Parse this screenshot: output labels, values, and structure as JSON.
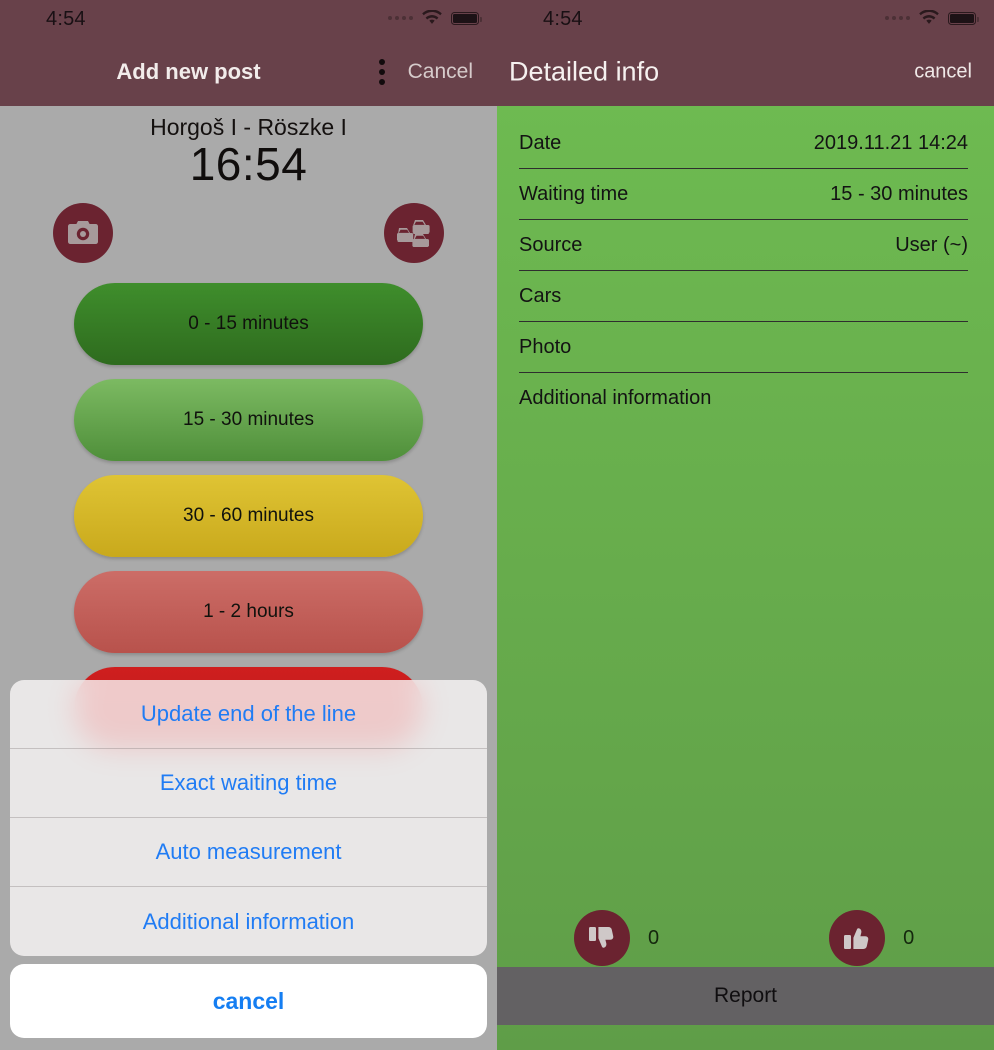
{
  "left": {
    "status": {
      "clock": "4:54",
      "wifi_icon": "wifi-icon",
      "battery_icon": "battery-icon",
      "signal_icon": "signal-dots-icon"
    },
    "navbar": {
      "title": "Add new post",
      "menu_icon": "kebab-menu-icon",
      "cancel_label": "Cancel"
    },
    "crossing": {
      "name": "Horgoš I - Röszke I",
      "time": "16:54"
    },
    "quick_icons": [
      {
        "name": "camera-icon",
        "label": "Camera"
      },
      {
        "name": "traffic-cars-icon",
        "label": "Cars"
      }
    ],
    "waiting_options": [
      {
        "label": "0 - 15 minutes",
        "color": "#3f8e2c"
      },
      {
        "label": "15 - 30 minutes",
        "color": "#7cba62"
      },
      {
        "label": "30  - 60 minutes",
        "color": "#dfc434"
      },
      {
        "label": "1 - 2 hours",
        "color": "#cc6d67"
      },
      {
        "label": "",
        "color": "#cf1f1f"
      }
    ],
    "action_sheet": {
      "items": [
        "Update end of the line",
        "Exact waiting time",
        "Auto measurement",
        "Additional information"
      ],
      "cancel_label": "cancel"
    }
  },
  "right": {
    "status": {
      "clock": "4:54",
      "wifi_icon": "wifi-icon",
      "battery_icon": "battery-icon",
      "signal_icon": "signal-dots-icon"
    },
    "navbar": {
      "title": "Detailed info",
      "cancel_label": "cancel"
    },
    "details": [
      {
        "label": "Date",
        "value": "2019.11.21 14:24"
      },
      {
        "label": "Waiting time",
        "value": "15 - 30 minutes"
      },
      {
        "label": "Source",
        "value": "User (~)"
      },
      {
        "label": "Cars",
        "value": ""
      },
      {
        "label": "Photo",
        "value": ""
      },
      {
        "label": "Additional information",
        "value": ""
      }
    ],
    "votes": {
      "down": {
        "icon": "thumbs-down-icon",
        "count": "0"
      },
      "up": {
        "icon": "thumbs-up-icon",
        "count": "0"
      }
    },
    "report_label": "Report"
  },
  "colors": {
    "navbar": "#68414a",
    "left_background": "#aaaaaa",
    "right_background": "#67ac4c",
    "accent_circle": "#6b2330",
    "link_blue": "#207cf4",
    "report_bar": "#636163"
  }
}
